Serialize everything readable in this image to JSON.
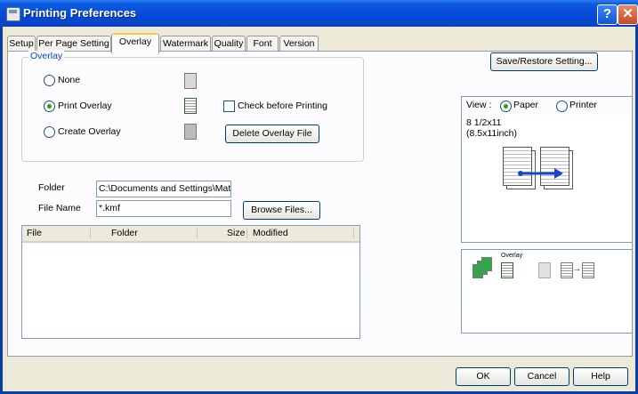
{
  "window": {
    "title": "Printing Preferences",
    "help_glyph": "?",
    "close_glyph": "✕"
  },
  "tabs": [
    "Setup",
    "Per Page Setting",
    "Overlay",
    "Watermark",
    "Quality",
    "Font",
    "Version"
  ],
  "overlay_group": {
    "label": "Overlay",
    "options": {
      "none": "None",
      "print": "Print Overlay",
      "create": "Create Overlay"
    },
    "selected": "Print Overlay",
    "check_before": "Check before Printing",
    "delete_button": "Delete Overlay File"
  },
  "folder": {
    "label": "Folder",
    "value": "C:\\Documents and Settings\\Mats"
  },
  "file_name": {
    "label": "File Name",
    "value": "*.kmf"
  },
  "browse_button": "Browse Files...",
  "file_list": {
    "columns": [
      "File",
      "Folder",
      "Size",
      "Modified"
    ]
  },
  "save_restore_button": "Save/Restore Setting...",
  "view": {
    "label": "View :",
    "paper": "Paper",
    "printer": "Printer",
    "selected": "Paper"
  },
  "paper_size": {
    "line1": "8 1/2x11",
    "line2": "(8.5x11inch)"
  },
  "overlay_preview_label": "Overlay",
  "buttons": {
    "ok": "OK",
    "cancel": "Cancel",
    "help": "Help"
  },
  "colors": {
    "title_bar": "#0649d8",
    "face": "#ece9d8",
    "tab_highlight": "#ffc73c",
    "group_label": "#0046d5"
  }
}
